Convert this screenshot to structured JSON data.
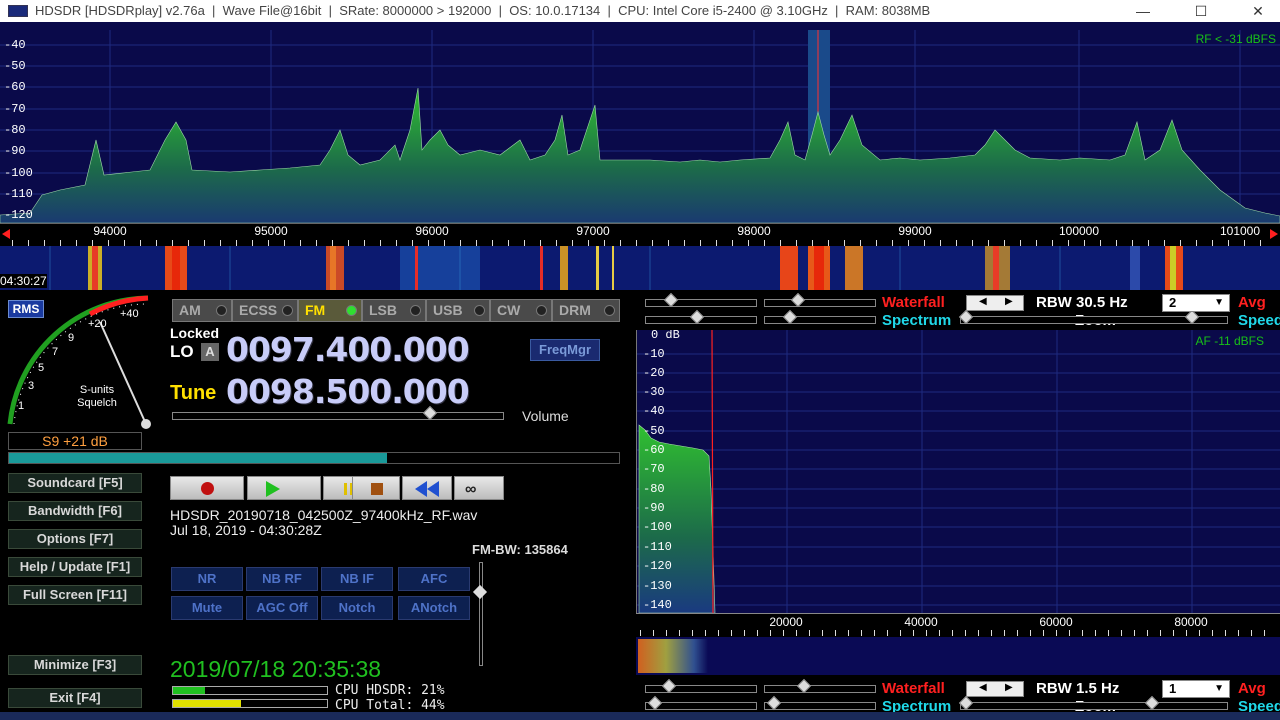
{
  "titlebar": {
    "app": "HDSDR",
    "mode": "[HDSDRplay]",
    "version": "v2.76a",
    "file": "Wave File@16bit",
    "srate": "SRate: 8000000 > 192000",
    "os": "OS: 10.0.17134",
    "cpu": "CPU: Intel Core i5-2400 @ 3.10GHz",
    "ram": "RAM: 8038MB",
    "minimize": "—",
    "maximize": "☐",
    "close": "✕"
  },
  "spectrum": {
    "db_labels": [
      "-40",
      "-50",
      "-60",
      "-70",
      "-80",
      "-90",
      "-100",
      "-110",
      "-120"
    ],
    "rf_level": "RF < -31 dBFS",
    "freq_labels": [
      "94000",
      "95000",
      "96000",
      "97000",
      "98000",
      "99000",
      "100000",
      "101000"
    ],
    "waterfall_time": "04:30:27"
  },
  "smeter": {
    "rms": "RMS",
    "scale": [
      "1",
      "3",
      "5",
      "7",
      "9",
      "+20",
      "+40"
    ],
    "sunits": "S-units",
    "squelch": "Squelch",
    "reading": "S9 +21 dB"
  },
  "modes": [
    {
      "label": "AM"
    },
    {
      "label": "ECSS"
    },
    {
      "label": "FM",
      "active": true
    },
    {
      "label": "LSB"
    },
    {
      "label": "USB"
    },
    {
      "label": "CW"
    },
    {
      "label": "DRM"
    }
  ],
  "lo": {
    "locked": "Locked",
    "label": "LO",
    "a": "A",
    "freq": "0097.400.000"
  },
  "tune": {
    "label": "Tune",
    "freq": "0098.500.000"
  },
  "freqmgr": "FreqMgr",
  "volume": "Volume",
  "left_buttons": [
    "Soundcard [F5]",
    "Bandwidth [F6]",
    "Options     [F7]",
    "Help / Update [F1]",
    "Full Screen [F11]",
    "Minimize [F3]",
    "Exit     [F4]"
  ],
  "recording": {
    "filename": "HDSDR_20190718_042500Z_97400kHz_RF.wav",
    "date": "Jul 18, 2019 - 04:30:28Z"
  },
  "fm_bw": "FM-BW: 135864",
  "dsp_buttons": [
    "NR",
    "NB RF",
    "NB IF",
    "AFC",
    "Mute",
    "AGC Off",
    "Notch",
    "ANotch"
  ],
  "clock": "2019/07/18 20:35:38",
  "cpu": {
    "hdsdr": "CPU HDSDR: 21%",
    "total": "CPU Total: 44%"
  },
  "rf_controls": {
    "waterfall": "Waterfall",
    "spectrum": "Spectrum",
    "rbw": "RBW 30.5 Hz",
    "zoom": "Zoom",
    "avg_value": "2",
    "avg": "Avg",
    "speed": "Speed"
  },
  "af_controls": {
    "waterfall": "Waterfall",
    "spectrum": "Spectrum",
    "rbw": "RBW  1.5 Hz",
    "zoom": "Zoom",
    "avg_value": "1",
    "avg": "Avg",
    "speed": "Speed"
  },
  "af_spectrum": {
    "db_labels": [
      "0 dB",
      "-10",
      "-20",
      "-30",
      "-40",
      "-50",
      "-60",
      "-70",
      "-80",
      "-90",
      "-100",
      "-110",
      "-120",
      "-130",
      "-140"
    ],
    "af_level": "AF -11 dBFS",
    "freq_labels": [
      "20000",
      "40000",
      "60000",
      "80000"
    ]
  },
  "colors": {
    "waterfall_red": "#ff2020",
    "spectrum_cyan": "#20d8e8",
    "freq_digits": "#c8ccf8",
    "tune_yellow": "#ffe000",
    "clock_green": "#20c020"
  }
}
